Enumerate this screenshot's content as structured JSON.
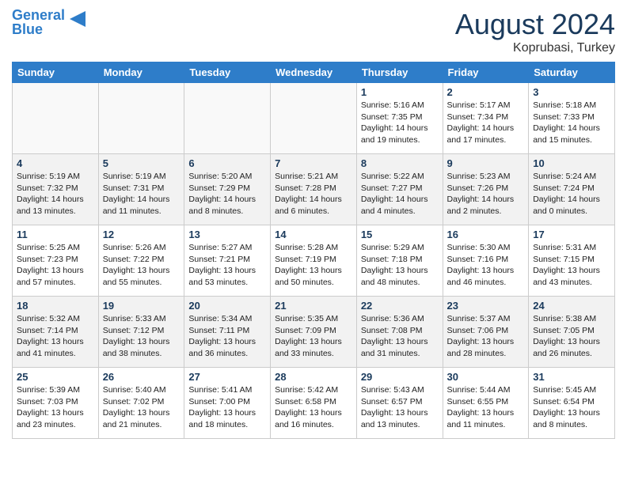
{
  "header": {
    "logo_line1": "General",
    "logo_line2": "Blue",
    "title": "August 2024",
    "location": "Koprubasi, Turkey"
  },
  "weekdays": [
    "Sunday",
    "Monday",
    "Tuesday",
    "Wednesday",
    "Thursday",
    "Friday",
    "Saturday"
  ],
  "weeks": [
    [
      {
        "day": "",
        "text": "",
        "empty": true
      },
      {
        "day": "",
        "text": "",
        "empty": true
      },
      {
        "day": "",
        "text": "",
        "empty": true
      },
      {
        "day": "",
        "text": "",
        "empty": true
      },
      {
        "day": "1",
        "text": "Sunrise: 5:16 AM\nSunset: 7:35 PM\nDaylight: 14 hours\nand 19 minutes.",
        "empty": false
      },
      {
        "day": "2",
        "text": "Sunrise: 5:17 AM\nSunset: 7:34 PM\nDaylight: 14 hours\nand 17 minutes.",
        "empty": false
      },
      {
        "day": "3",
        "text": "Sunrise: 5:18 AM\nSunset: 7:33 PM\nDaylight: 14 hours\nand 15 minutes.",
        "empty": false
      }
    ],
    [
      {
        "day": "4",
        "text": "Sunrise: 5:19 AM\nSunset: 7:32 PM\nDaylight: 14 hours\nand 13 minutes.",
        "empty": false
      },
      {
        "day": "5",
        "text": "Sunrise: 5:19 AM\nSunset: 7:31 PM\nDaylight: 14 hours\nand 11 minutes.",
        "empty": false
      },
      {
        "day": "6",
        "text": "Sunrise: 5:20 AM\nSunset: 7:29 PM\nDaylight: 14 hours\nand 8 minutes.",
        "empty": false
      },
      {
        "day": "7",
        "text": "Sunrise: 5:21 AM\nSunset: 7:28 PM\nDaylight: 14 hours\nand 6 minutes.",
        "empty": false
      },
      {
        "day": "8",
        "text": "Sunrise: 5:22 AM\nSunset: 7:27 PM\nDaylight: 14 hours\nand 4 minutes.",
        "empty": false
      },
      {
        "day": "9",
        "text": "Sunrise: 5:23 AM\nSunset: 7:26 PM\nDaylight: 14 hours\nand 2 minutes.",
        "empty": false
      },
      {
        "day": "10",
        "text": "Sunrise: 5:24 AM\nSunset: 7:24 PM\nDaylight: 14 hours\nand 0 minutes.",
        "empty": false
      }
    ],
    [
      {
        "day": "11",
        "text": "Sunrise: 5:25 AM\nSunset: 7:23 PM\nDaylight: 13 hours\nand 57 minutes.",
        "empty": false
      },
      {
        "day": "12",
        "text": "Sunrise: 5:26 AM\nSunset: 7:22 PM\nDaylight: 13 hours\nand 55 minutes.",
        "empty": false
      },
      {
        "day": "13",
        "text": "Sunrise: 5:27 AM\nSunset: 7:21 PM\nDaylight: 13 hours\nand 53 minutes.",
        "empty": false
      },
      {
        "day": "14",
        "text": "Sunrise: 5:28 AM\nSunset: 7:19 PM\nDaylight: 13 hours\nand 50 minutes.",
        "empty": false
      },
      {
        "day": "15",
        "text": "Sunrise: 5:29 AM\nSunset: 7:18 PM\nDaylight: 13 hours\nand 48 minutes.",
        "empty": false
      },
      {
        "day": "16",
        "text": "Sunrise: 5:30 AM\nSunset: 7:16 PM\nDaylight: 13 hours\nand 46 minutes.",
        "empty": false
      },
      {
        "day": "17",
        "text": "Sunrise: 5:31 AM\nSunset: 7:15 PM\nDaylight: 13 hours\nand 43 minutes.",
        "empty": false
      }
    ],
    [
      {
        "day": "18",
        "text": "Sunrise: 5:32 AM\nSunset: 7:14 PM\nDaylight: 13 hours\nand 41 minutes.",
        "empty": false
      },
      {
        "day": "19",
        "text": "Sunrise: 5:33 AM\nSunset: 7:12 PM\nDaylight: 13 hours\nand 38 minutes.",
        "empty": false
      },
      {
        "day": "20",
        "text": "Sunrise: 5:34 AM\nSunset: 7:11 PM\nDaylight: 13 hours\nand 36 minutes.",
        "empty": false
      },
      {
        "day": "21",
        "text": "Sunrise: 5:35 AM\nSunset: 7:09 PM\nDaylight: 13 hours\nand 33 minutes.",
        "empty": false
      },
      {
        "day": "22",
        "text": "Sunrise: 5:36 AM\nSunset: 7:08 PM\nDaylight: 13 hours\nand 31 minutes.",
        "empty": false
      },
      {
        "day": "23",
        "text": "Sunrise: 5:37 AM\nSunset: 7:06 PM\nDaylight: 13 hours\nand 28 minutes.",
        "empty": false
      },
      {
        "day": "24",
        "text": "Sunrise: 5:38 AM\nSunset: 7:05 PM\nDaylight: 13 hours\nand 26 minutes.",
        "empty": false
      }
    ],
    [
      {
        "day": "25",
        "text": "Sunrise: 5:39 AM\nSunset: 7:03 PM\nDaylight: 13 hours\nand 23 minutes.",
        "empty": false
      },
      {
        "day": "26",
        "text": "Sunrise: 5:40 AM\nSunset: 7:02 PM\nDaylight: 13 hours\nand 21 minutes.",
        "empty": false
      },
      {
        "day": "27",
        "text": "Sunrise: 5:41 AM\nSunset: 7:00 PM\nDaylight: 13 hours\nand 18 minutes.",
        "empty": false
      },
      {
        "day": "28",
        "text": "Sunrise: 5:42 AM\nSunset: 6:58 PM\nDaylight: 13 hours\nand 16 minutes.",
        "empty": false
      },
      {
        "day": "29",
        "text": "Sunrise: 5:43 AM\nSunset: 6:57 PM\nDaylight: 13 hours\nand 13 minutes.",
        "empty": false
      },
      {
        "day": "30",
        "text": "Sunrise: 5:44 AM\nSunset: 6:55 PM\nDaylight: 13 hours\nand 11 minutes.",
        "empty": false
      },
      {
        "day": "31",
        "text": "Sunrise: 5:45 AM\nSunset: 6:54 PM\nDaylight: 13 hours\nand 8 minutes.",
        "empty": false
      }
    ]
  ]
}
